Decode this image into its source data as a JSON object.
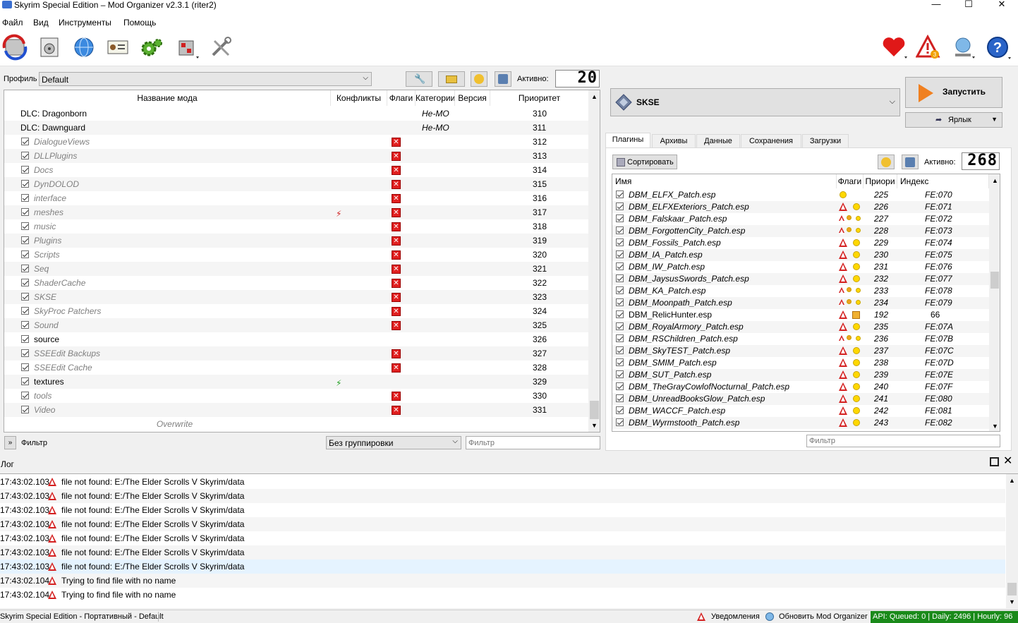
{
  "window": {
    "title": "Skyrim Special Edition – Mod Organizer v2.3.1 (riter2)",
    "min": "—",
    "max": "☐",
    "close": "✕"
  },
  "menu": [
    "Файл",
    "Вид",
    "Инструменты",
    "Помощь"
  ],
  "profile": {
    "label": "Профиль",
    "value": "Default",
    "active_label": "Активно:",
    "active_count": "20"
  },
  "modlist": {
    "headers": {
      "name": "Название мода",
      "conflicts": "Конфликты",
      "flags": "Флаги",
      "category": "Категории",
      "version": "Версия",
      "priority": "Приоритет"
    },
    "rows": [
      {
        "name": "DLC: Dragonborn",
        "category": "Не-МО",
        "priority": "310",
        "check": false,
        "style": "normal",
        "flag": ""
      },
      {
        "name": "DLC: Dawnguard",
        "category": "Не-МО",
        "priority": "311",
        "check": false,
        "style": "normal",
        "flag": ""
      },
      {
        "name": "DialogueViews",
        "category": "",
        "priority": "312",
        "check": true,
        "style": "gray",
        "flag": "x"
      },
      {
        "name": "DLLPlugins",
        "category": "",
        "priority": "313",
        "check": true,
        "style": "gray",
        "flag": "x"
      },
      {
        "name": "Docs",
        "category": "",
        "priority": "314",
        "check": true,
        "style": "gray",
        "flag": "x"
      },
      {
        "name": "DynDOLOD",
        "category": "",
        "priority": "315",
        "check": true,
        "style": "gray",
        "flag": "x"
      },
      {
        "name": "interface",
        "category": "",
        "priority": "316",
        "check": true,
        "style": "gray",
        "flag": "x"
      },
      {
        "name": "meshes",
        "category": "",
        "priority": "317",
        "check": true,
        "style": "gray",
        "flag": "x",
        "conflict": "red"
      },
      {
        "name": "music",
        "category": "",
        "priority": "318",
        "check": true,
        "style": "gray",
        "flag": "x"
      },
      {
        "name": "Plugins",
        "category": "",
        "priority": "319",
        "check": true,
        "style": "gray",
        "flag": "x"
      },
      {
        "name": "Scripts",
        "category": "",
        "priority": "320",
        "check": true,
        "style": "gray",
        "flag": "x"
      },
      {
        "name": "Seq",
        "category": "",
        "priority": "321",
        "check": true,
        "style": "gray",
        "flag": "x"
      },
      {
        "name": "ShaderCache",
        "category": "",
        "priority": "322",
        "check": true,
        "style": "gray",
        "flag": "x"
      },
      {
        "name": "SKSE",
        "category": "",
        "priority": "323",
        "check": true,
        "style": "gray",
        "flag": "x"
      },
      {
        "name": "SkyProc Patchers",
        "category": "",
        "priority": "324",
        "check": true,
        "style": "gray",
        "flag": "x"
      },
      {
        "name": "Sound",
        "category": "",
        "priority": "325",
        "check": true,
        "style": "gray",
        "flag": "x"
      },
      {
        "name": "source",
        "category": "",
        "priority": "326",
        "check": true,
        "style": "normal",
        "flag": ""
      },
      {
        "name": "SSEEdit Backups",
        "category": "",
        "priority": "327",
        "check": true,
        "style": "gray",
        "flag": "x"
      },
      {
        "name": "SSEEdit Cache",
        "category": "",
        "priority": "328",
        "check": true,
        "style": "gray",
        "flag": "x"
      },
      {
        "name": "textures",
        "category": "",
        "priority": "329",
        "check": true,
        "style": "normal",
        "flag": "",
        "conflict": "green"
      },
      {
        "name": "tools",
        "category": "",
        "priority": "330",
        "check": true,
        "style": "gray",
        "flag": "x"
      },
      {
        "name": "Video",
        "category": "",
        "priority": "331",
        "check": true,
        "style": "gray",
        "flag": "x"
      }
    ],
    "overwrite": "Overwrite",
    "filter_label": "Фильтр",
    "grouping": "Без группировки",
    "filter_placeholder": "Фильтр"
  },
  "executable": {
    "name": "SKSE",
    "run_label": "Запустить",
    "shortcut_label": "Ярлык"
  },
  "tabs": [
    "Плагины",
    "Архивы",
    "Данные",
    "Сохранения",
    "Загрузки"
  ],
  "plugins": {
    "sort_label": "Сортировать",
    "active_label": "Активно:",
    "active_count": "268",
    "headers": {
      "name": "Имя",
      "flags": "Флаги",
      "priority": "Приори",
      "index": "Индекс"
    },
    "rows": [
      {
        "name": "DBM_ELFX_Patch.esp",
        "priority": "225",
        "index": "FE:070",
        "flags": "dot"
      },
      {
        "name": "DBM_ELFXExteriors_Patch.esp",
        "priority": "226",
        "index": "FE:071",
        "flags": "warn-dot"
      },
      {
        "name": "DBM_Falskaar_Patch.esp",
        "priority": "227",
        "index": "FE:072",
        "flags": "small"
      },
      {
        "name": "DBM_ForgottenCity_Patch.esp",
        "priority": "228",
        "index": "FE:073",
        "flags": "small"
      },
      {
        "name": "DBM_Fossils_Patch.esp",
        "priority": "229",
        "index": "FE:074",
        "flags": "warn-dot"
      },
      {
        "name": "DBM_IA_Patch.esp",
        "priority": "230",
        "index": "FE:075",
        "flags": "warn-dot"
      },
      {
        "name": "DBM_IW_Patch.esp",
        "priority": "231",
        "index": "FE:076",
        "flags": "warn-dot"
      },
      {
        "name": "DBM_JaysusSwords_Patch.esp",
        "priority": "232",
        "index": "FE:077",
        "flags": "warn-dot"
      },
      {
        "name": "DBM_KA_Patch.esp",
        "priority": "233",
        "index": "FE:078",
        "flags": "small"
      },
      {
        "name": "DBM_Moonpath_Patch.esp",
        "priority": "234",
        "index": "FE:079",
        "flags": "small"
      },
      {
        "name": "DBM_RelicHunter.esp",
        "priority": "192",
        "index": "66",
        "flags": "warn-box",
        "normal": true
      },
      {
        "name": "DBM_RoyalArmory_Patch.esp",
        "priority": "235",
        "index": "FE:07A",
        "flags": "warn-dot"
      },
      {
        "name": "DBM_RSChildren_Patch.esp",
        "priority": "236",
        "index": "FE:07B",
        "flags": "small"
      },
      {
        "name": "DBM_SkyTEST_Patch.esp",
        "priority": "237",
        "index": "FE:07C",
        "flags": "warn-dot"
      },
      {
        "name": "DBM_SMIM_Patch.esp",
        "priority": "238",
        "index": "FE:07D",
        "flags": "warn-dot"
      },
      {
        "name": "DBM_SUT_Patch.esp",
        "priority": "239",
        "index": "FE:07E",
        "flags": "warn-dot"
      },
      {
        "name": "DBM_TheGrayCowlofNocturnal_Patch.esp",
        "priority": "240",
        "index": "FE:07F",
        "flags": "warn-dot"
      },
      {
        "name": "DBM_UnreadBooksGlow_Patch.esp",
        "priority": "241",
        "index": "FE:080",
        "flags": "warn-dot"
      },
      {
        "name": "DBM_WACCF_Patch.esp",
        "priority": "242",
        "index": "FE:081",
        "flags": "warn-dot"
      },
      {
        "name": "DBM_Wyrmstooth_Patch.esp",
        "priority": "243",
        "index": "FE:082",
        "flags": "warn-dot"
      }
    ],
    "filter_placeholder": "Фильтр"
  },
  "log": {
    "title": "Лог",
    "entries": [
      {
        "time": "17:43:02.103",
        "msg": "file not found: E:/The Elder Scrolls V Skyrim/data"
      },
      {
        "time": "17:43:02.103",
        "msg": "file not found: E:/The Elder Scrolls V Skyrim/data"
      },
      {
        "time": "17:43:02.103",
        "msg": "file not found: E:/The Elder Scrolls V Skyrim/data"
      },
      {
        "time": "17:43:02.103",
        "msg": "file not found: E:/The Elder Scrolls V Skyrim/data"
      },
      {
        "time": "17:43:02.103",
        "msg": "file not found: E:/The Elder Scrolls V Skyrim/data"
      },
      {
        "time": "17:43:02.103",
        "msg": "file not found: E:/The Elder Scrolls V Skyrim/data"
      },
      {
        "time": "17:43:02.103",
        "msg": "file not found: E:/The Elder Scrolls V Skyrim/data"
      },
      {
        "time": "17:43:02.104",
        "msg": "Trying to find file with no name"
      },
      {
        "time": "17:43:02.104",
        "msg": "Trying to find file with no name"
      }
    ]
  },
  "status": {
    "left": "Skyrim Special Edition - Портативный - Default",
    "notifications": "Уведомления",
    "update": "Обновить Mod Organizer",
    "api": "API: Queued: 0 | Daily: 2496 | Hourly: 96"
  }
}
